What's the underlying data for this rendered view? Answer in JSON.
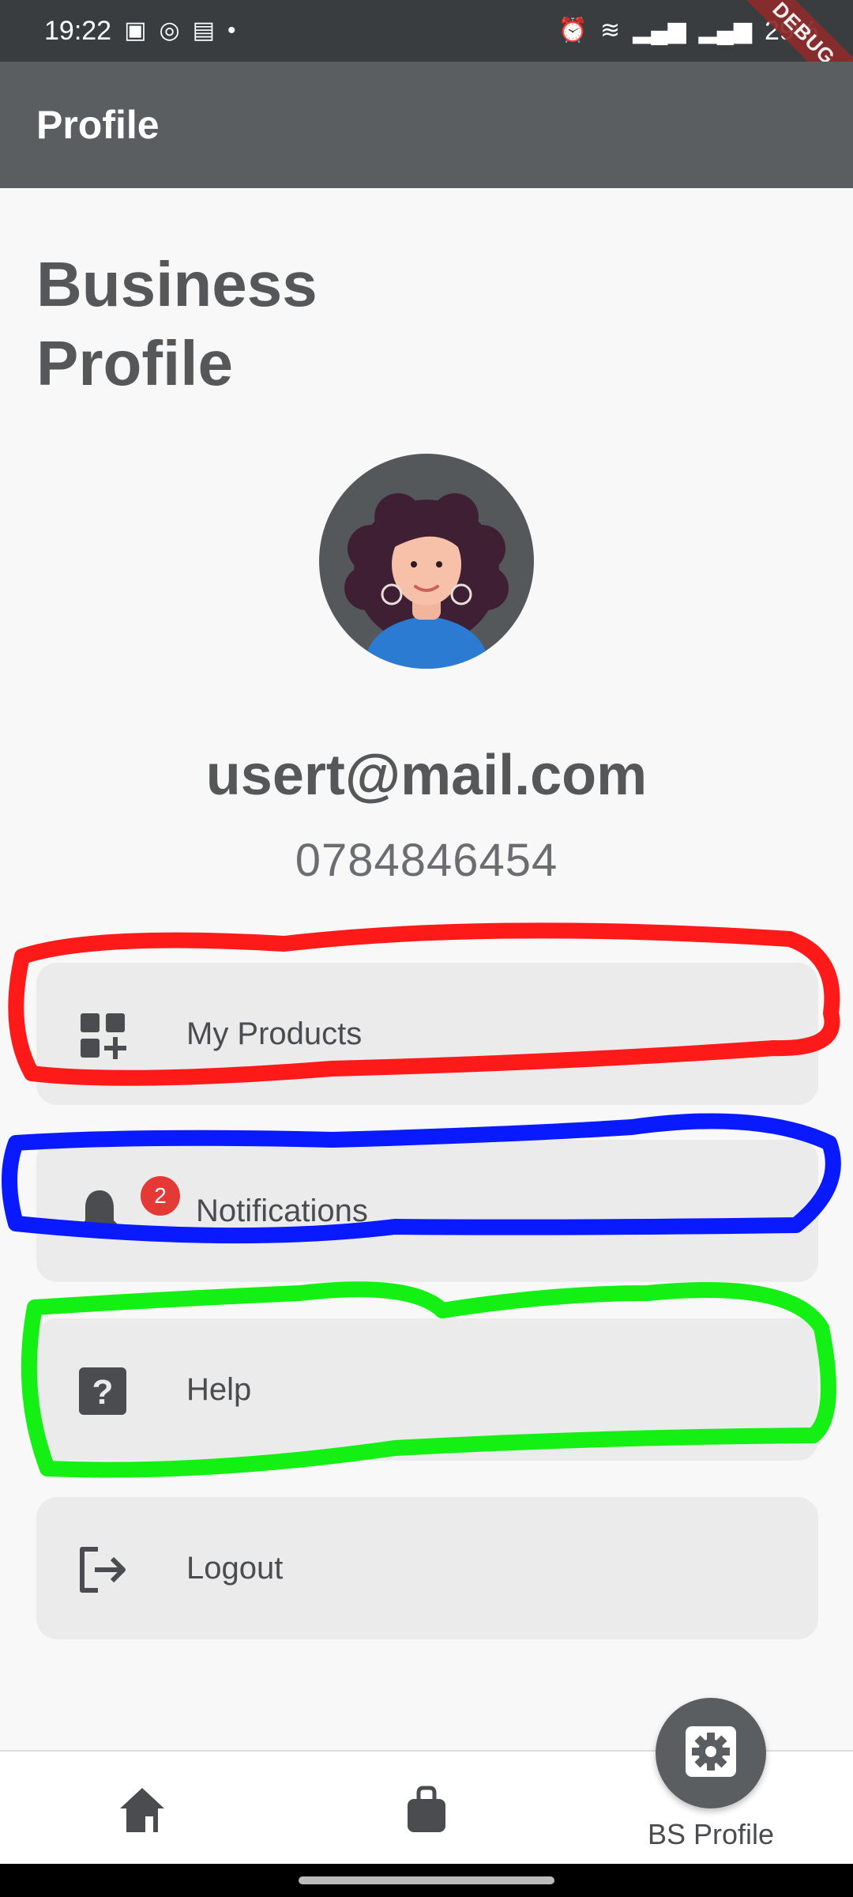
{
  "status_bar": {
    "time": "19:22",
    "battery": "29%",
    "debug_label": "DEBUG"
  },
  "app_bar": {
    "title": "Profile"
  },
  "page": {
    "title": "Business Profile"
  },
  "profile": {
    "email": "usert@mail.com",
    "phone": "0784846454"
  },
  "menu": {
    "items": [
      {
        "label": "My Products",
        "icon": "grid-plus-icon"
      },
      {
        "label": "Notifications",
        "icon": "bell-icon",
        "badge": "2"
      },
      {
        "label": "Help",
        "icon": "help-square-icon"
      },
      {
        "label": "Logout",
        "icon": "logout-icon"
      }
    ]
  },
  "bottom_nav": {
    "items": [
      {
        "icon": "home-icon"
      },
      {
        "icon": "bag-icon"
      },
      {
        "icon": "settings-icon",
        "label": "BS Profile",
        "active": true
      }
    ]
  },
  "colors": {
    "app_bar": "#5b5e61",
    "status_bar": "#3a3d40",
    "menu_bg": "#ebebeb",
    "badge": "#e53935",
    "annotation_red": "#ff1a1a",
    "annotation_blue": "#0a1aff",
    "annotation_green": "#14f014"
  }
}
